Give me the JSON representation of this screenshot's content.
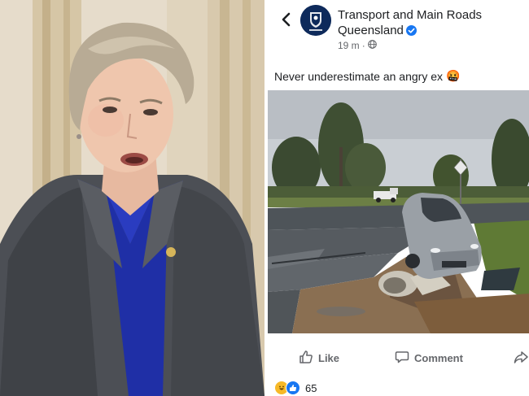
{
  "post": {
    "page_name": "Transport and Main Roads Queensland",
    "avatar_caption": "Queensland Government",
    "timestamp": "19 m",
    "dot": "·",
    "text": "Never underestimate an angry ex",
    "emoji": "🤬"
  },
  "actions": {
    "like_label": "Like",
    "comment_label": "Comment"
  },
  "reactions": {
    "count": "65"
  },
  "colors": {
    "facebook_blue": "#1877f2",
    "verified_blue": "#1877f2",
    "text_gray": "#65676b",
    "haha_yellow": "#f7b928",
    "qld_navy": "#0e2a5b"
  }
}
